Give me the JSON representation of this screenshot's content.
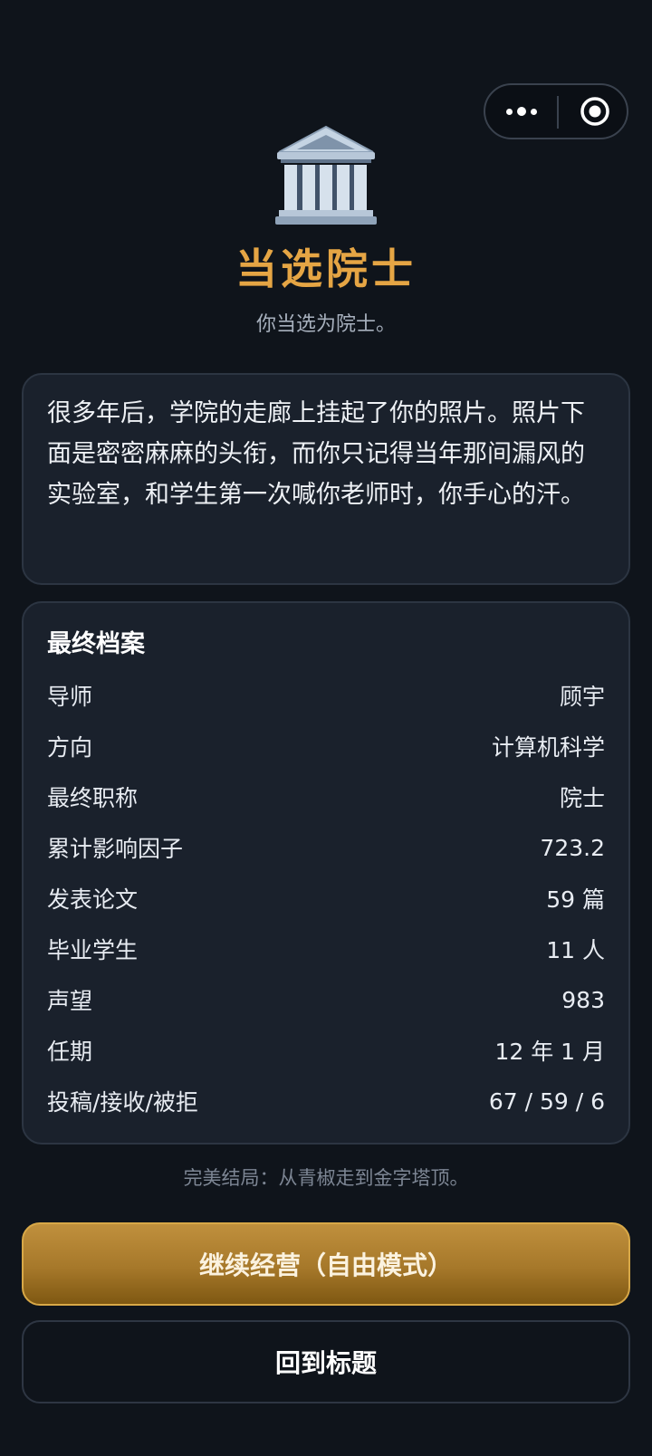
{
  "nav": {
    "more_icon": "more-dots-icon",
    "close_icon": "target-circle-icon"
  },
  "hero": {
    "icon": "classical-building-icon",
    "title": "当选院士",
    "subtitle": "你当选为院士。"
  },
  "story": {
    "text": "很多年后，学院的走廊上挂起了你的照片。照片下面是密密麻麻的头衔，而你只记得当年那间漏风的实验室，和学生第一次喊你老师时，你手心的汗。"
  },
  "record": {
    "title": "最终档案",
    "rows": [
      {
        "label": "导师",
        "value": "顾宇"
      },
      {
        "label": "方向",
        "value": "计算机科学"
      },
      {
        "label": "最终职称",
        "value": "院士"
      },
      {
        "label": "累计影响因子",
        "value": "723.2"
      },
      {
        "label": "发表论文",
        "value": "59 篇"
      },
      {
        "label": "毕业学生",
        "value": "11 人"
      },
      {
        "label": "声望",
        "value": "983"
      },
      {
        "label": "任期",
        "value": "12 年 1 月"
      },
      {
        "label": "投稿/接收/被拒",
        "value": "67 / 59 / 6"
      }
    ]
  },
  "ending": {
    "text": "完美结局：从青椒走到金字塔顶。"
  },
  "buttons": {
    "continue_label": "继续经营（自由模式）",
    "title_label": "回到标题"
  },
  "colors": {
    "background": "#0f141b",
    "card": "#1a212c",
    "accent_gold": "#e5a544",
    "button_gold": "#a6782a"
  }
}
